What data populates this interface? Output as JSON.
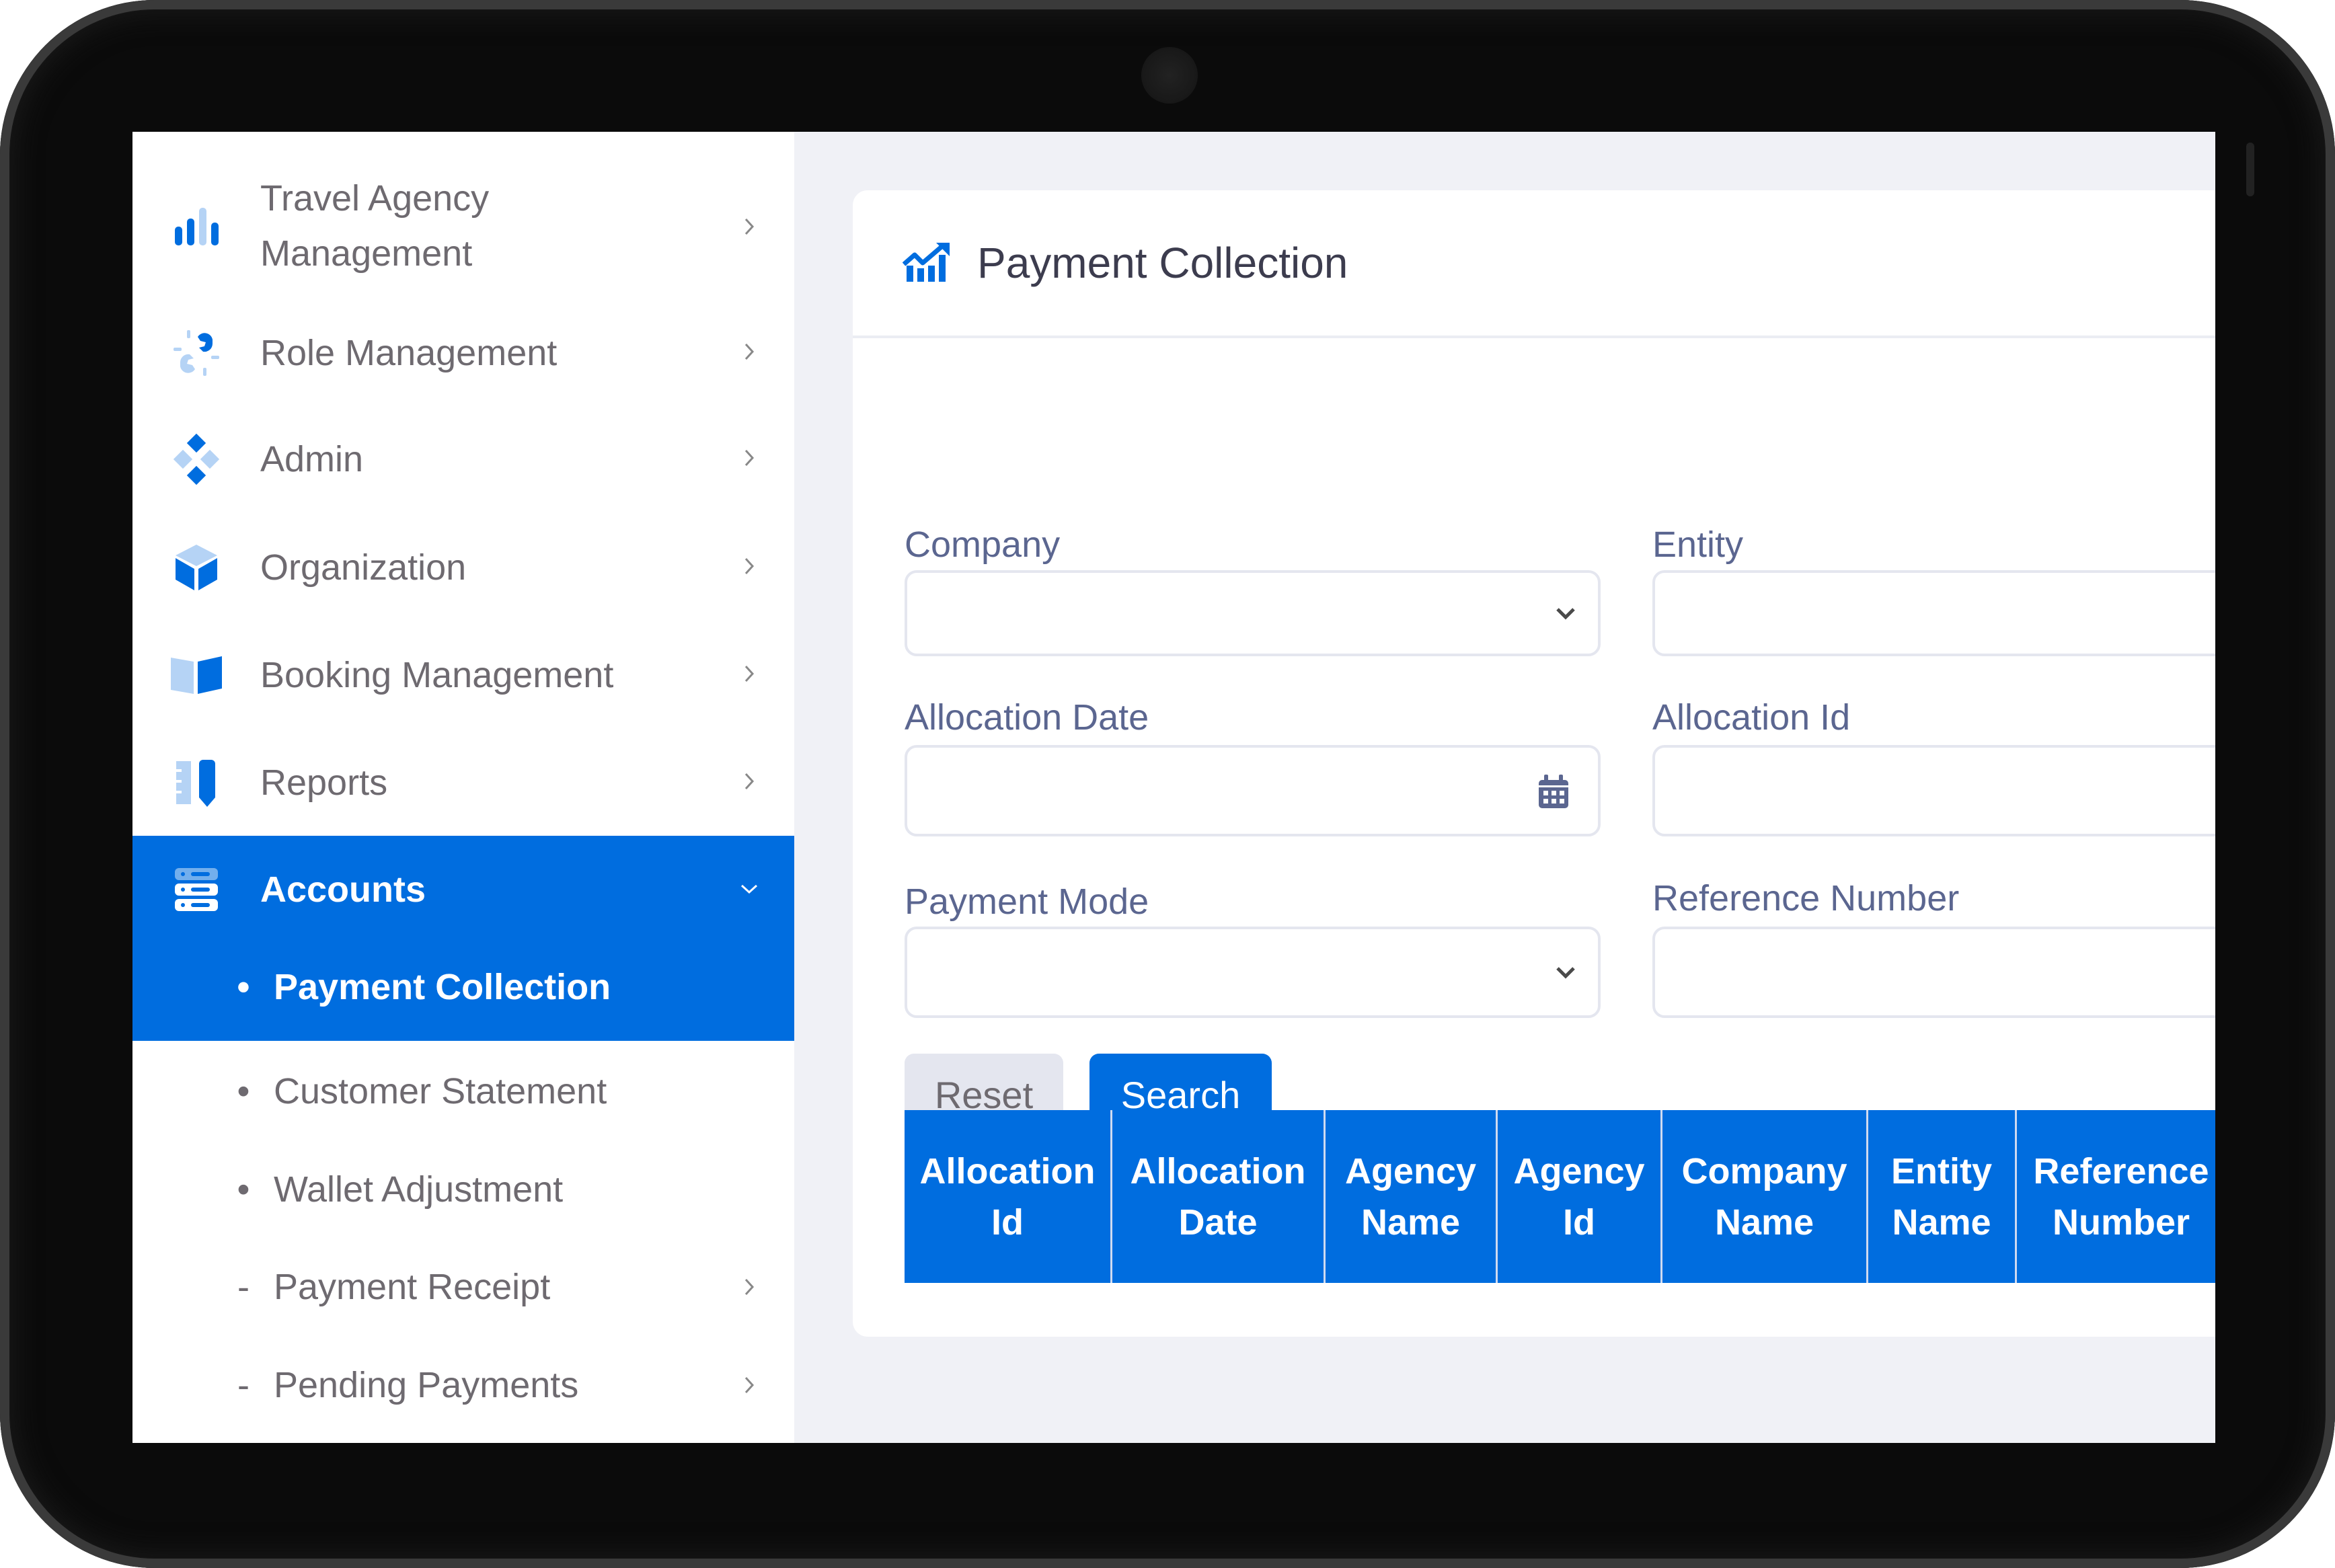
{
  "sidebar": {
    "items": [
      {
        "label": "Travel Agency Management",
        "line1": "Travel Agency",
        "line2": "Management",
        "icon": "bar-chart-icon"
      },
      {
        "label": "Role Management",
        "icon": "broken-link-icon"
      },
      {
        "label": "Admin",
        "icon": "diamonds-icon"
      },
      {
        "label": "Organization",
        "icon": "cube-icon"
      },
      {
        "label": "Booking Management",
        "icon": "book-icon"
      },
      {
        "label": "Reports",
        "icon": "ruler-pencil-icon"
      },
      {
        "label": "Accounts",
        "icon": "server-icon",
        "expanded": true,
        "active": true
      }
    ],
    "sub_items": [
      {
        "label": "Payment Collection",
        "bullet": "•",
        "active": true
      },
      {
        "label": "Customer Statement",
        "bullet": "•"
      },
      {
        "label": "Wallet Adjustment",
        "bullet": "•"
      },
      {
        "label": "Payment Receipt",
        "bullet": "-",
        "has_children": true
      },
      {
        "label": "Pending Payments",
        "bullet": "-",
        "has_children": true
      }
    ]
  },
  "page": {
    "title": "Payment Collection",
    "icon": "chart-growth-icon"
  },
  "form": {
    "company": {
      "label": "Company",
      "value": ""
    },
    "entity": {
      "label": "Entity",
      "value": ""
    },
    "allocation_date": {
      "label": "Allocation Date",
      "value": ""
    },
    "allocation_id": {
      "label": "Allocation Id",
      "value": ""
    },
    "payment_mode": {
      "label": "Payment Mode",
      "value": ""
    },
    "reference_number": {
      "label": "Reference Number",
      "value": ""
    },
    "reset_label": "Reset",
    "search_label": "Search"
  },
  "table": {
    "columns": [
      "Allocation\nId",
      "Allocation\nDate",
      "Agency\nName",
      "Agency\nId",
      "Company\nName",
      "Entity\nName",
      "Reference\nNumber"
    ],
    "rows": []
  },
  "colors": {
    "accent": "#006ddf",
    "icon_light": "#b5d3f5",
    "text_muted": "#6e6a70",
    "label": "#5b6690",
    "background": "#f0f1f6"
  }
}
